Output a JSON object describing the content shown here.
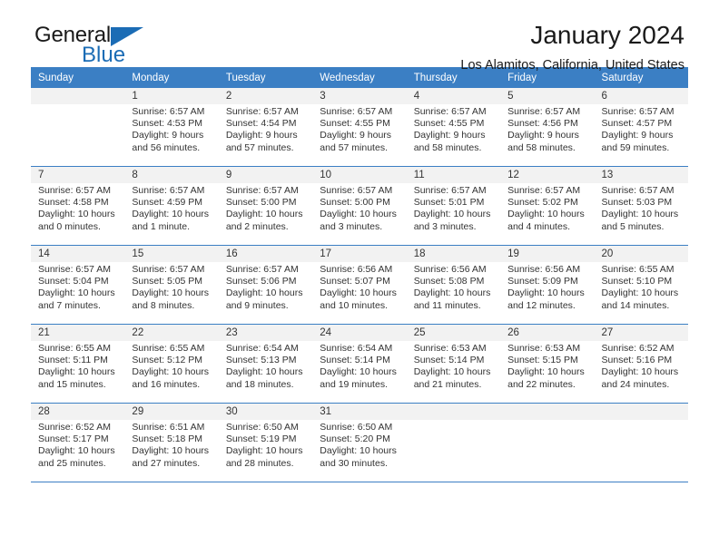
{
  "brand": {
    "name_dark": "General",
    "name_blue": "Blue",
    "triangle_icon": "triangle-icon",
    "accent_color": "#1b6cb5"
  },
  "header": {
    "month_title": "January 2024",
    "location": "Los Alamitos, California, United States"
  },
  "colors": {
    "header_blue": "#3b7fc4",
    "daynum_bg": "#f2f2f2",
    "text": "#333333"
  },
  "calendar": {
    "weekday_headers": [
      "Sunday",
      "Monday",
      "Tuesday",
      "Wednesday",
      "Thursday",
      "Friday",
      "Saturday"
    ],
    "weeks": [
      [
        {
          "day": "",
          "sunrise": "",
          "sunset": "",
          "daylight_l1": "",
          "daylight_l2": "",
          "empty": true
        },
        {
          "day": "1",
          "sunrise": "Sunrise: 6:57 AM",
          "sunset": "Sunset: 4:53 PM",
          "daylight_l1": "Daylight: 9 hours",
          "daylight_l2": "and 56 minutes."
        },
        {
          "day": "2",
          "sunrise": "Sunrise: 6:57 AM",
          "sunset": "Sunset: 4:54 PM",
          "daylight_l1": "Daylight: 9 hours",
          "daylight_l2": "and 57 minutes."
        },
        {
          "day": "3",
          "sunrise": "Sunrise: 6:57 AM",
          "sunset": "Sunset: 4:55 PM",
          "daylight_l1": "Daylight: 9 hours",
          "daylight_l2": "and 57 minutes."
        },
        {
          "day": "4",
          "sunrise": "Sunrise: 6:57 AM",
          "sunset": "Sunset: 4:55 PM",
          "daylight_l1": "Daylight: 9 hours",
          "daylight_l2": "and 58 minutes."
        },
        {
          "day": "5",
          "sunrise": "Sunrise: 6:57 AM",
          "sunset": "Sunset: 4:56 PM",
          "daylight_l1": "Daylight: 9 hours",
          "daylight_l2": "and 58 minutes."
        },
        {
          "day": "6",
          "sunrise": "Sunrise: 6:57 AM",
          "sunset": "Sunset: 4:57 PM",
          "daylight_l1": "Daylight: 9 hours",
          "daylight_l2": "and 59 minutes."
        }
      ],
      [
        {
          "day": "7",
          "sunrise": "Sunrise: 6:57 AM",
          "sunset": "Sunset: 4:58 PM",
          "daylight_l1": "Daylight: 10 hours",
          "daylight_l2": "and 0 minutes."
        },
        {
          "day": "8",
          "sunrise": "Sunrise: 6:57 AM",
          "sunset": "Sunset: 4:59 PM",
          "daylight_l1": "Daylight: 10 hours",
          "daylight_l2": "and 1 minute."
        },
        {
          "day": "9",
          "sunrise": "Sunrise: 6:57 AM",
          "sunset": "Sunset: 5:00 PM",
          "daylight_l1": "Daylight: 10 hours",
          "daylight_l2": "and 2 minutes."
        },
        {
          "day": "10",
          "sunrise": "Sunrise: 6:57 AM",
          "sunset": "Sunset: 5:00 PM",
          "daylight_l1": "Daylight: 10 hours",
          "daylight_l2": "and 3 minutes."
        },
        {
          "day": "11",
          "sunrise": "Sunrise: 6:57 AM",
          "sunset": "Sunset: 5:01 PM",
          "daylight_l1": "Daylight: 10 hours",
          "daylight_l2": "and 3 minutes."
        },
        {
          "day": "12",
          "sunrise": "Sunrise: 6:57 AM",
          "sunset": "Sunset: 5:02 PM",
          "daylight_l1": "Daylight: 10 hours",
          "daylight_l2": "and 4 minutes."
        },
        {
          "day": "13",
          "sunrise": "Sunrise: 6:57 AM",
          "sunset": "Sunset: 5:03 PM",
          "daylight_l1": "Daylight: 10 hours",
          "daylight_l2": "and 5 minutes."
        }
      ],
      [
        {
          "day": "14",
          "sunrise": "Sunrise: 6:57 AM",
          "sunset": "Sunset: 5:04 PM",
          "daylight_l1": "Daylight: 10 hours",
          "daylight_l2": "and 7 minutes."
        },
        {
          "day": "15",
          "sunrise": "Sunrise: 6:57 AM",
          "sunset": "Sunset: 5:05 PM",
          "daylight_l1": "Daylight: 10 hours",
          "daylight_l2": "and 8 minutes."
        },
        {
          "day": "16",
          "sunrise": "Sunrise: 6:57 AM",
          "sunset": "Sunset: 5:06 PM",
          "daylight_l1": "Daylight: 10 hours",
          "daylight_l2": "and 9 minutes."
        },
        {
          "day": "17",
          "sunrise": "Sunrise: 6:56 AM",
          "sunset": "Sunset: 5:07 PM",
          "daylight_l1": "Daylight: 10 hours",
          "daylight_l2": "and 10 minutes."
        },
        {
          "day": "18",
          "sunrise": "Sunrise: 6:56 AM",
          "sunset": "Sunset: 5:08 PM",
          "daylight_l1": "Daylight: 10 hours",
          "daylight_l2": "and 11 minutes."
        },
        {
          "day": "19",
          "sunrise": "Sunrise: 6:56 AM",
          "sunset": "Sunset: 5:09 PM",
          "daylight_l1": "Daylight: 10 hours",
          "daylight_l2": "and 12 minutes."
        },
        {
          "day": "20",
          "sunrise": "Sunrise: 6:55 AM",
          "sunset": "Sunset: 5:10 PM",
          "daylight_l1": "Daylight: 10 hours",
          "daylight_l2": "and 14 minutes."
        }
      ],
      [
        {
          "day": "21",
          "sunrise": "Sunrise: 6:55 AM",
          "sunset": "Sunset: 5:11 PM",
          "daylight_l1": "Daylight: 10 hours",
          "daylight_l2": "and 15 minutes."
        },
        {
          "day": "22",
          "sunrise": "Sunrise: 6:55 AM",
          "sunset": "Sunset: 5:12 PM",
          "daylight_l1": "Daylight: 10 hours",
          "daylight_l2": "and 16 minutes."
        },
        {
          "day": "23",
          "sunrise": "Sunrise: 6:54 AM",
          "sunset": "Sunset: 5:13 PM",
          "daylight_l1": "Daylight: 10 hours",
          "daylight_l2": "and 18 minutes."
        },
        {
          "day": "24",
          "sunrise": "Sunrise: 6:54 AM",
          "sunset": "Sunset: 5:14 PM",
          "daylight_l1": "Daylight: 10 hours",
          "daylight_l2": "and 19 minutes."
        },
        {
          "day": "25",
          "sunrise": "Sunrise: 6:53 AM",
          "sunset": "Sunset: 5:14 PM",
          "daylight_l1": "Daylight: 10 hours",
          "daylight_l2": "and 21 minutes."
        },
        {
          "day": "26",
          "sunrise": "Sunrise: 6:53 AM",
          "sunset": "Sunset: 5:15 PM",
          "daylight_l1": "Daylight: 10 hours",
          "daylight_l2": "and 22 minutes."
        },
        {
          "day": "27",
          "sunrise": "Sunrise: 6:52 AM",
          "sunset": "Sunset: 5:16 PM",
          "daylight_l1": "Daylight: 10 hours",
          "daylight_l2": "and 24 minutes."
        }
      ],
      [
        {
          "day": "28",
          "sunrise": "Sunrise: 6:52 AM",
          "sunset": "Sunset: 5:17 PM",
          "daylight_l1": "Daylight: 10 hours",
          "daylight_l2": "and 25 minutes."
        },
        {
          "day": "29",
          "sunrise": "Sunrise: 6:51 AM",
          "sunset": "Sunset: 5:18 PM",
          "daylight_l1": "Daylight: 10 hours",
          "daylight_l2": "and 27 minutes."
        },
        {
          "day": "30",
          "sunrise": "Sunrise: 6:50 AM",
          "sunset": "Sunset: 5:19 PM",
          "daylight_l1": "Daylight: 10 hours",
          "daylight_l2": "and 28 minutes."
        },
        {
          "day": "31",
          "sunrise": "Sunrise: 6:50 AM",
          "sunset": "Sunset: 5:20 PM",
          "daylight_l1": "Daylight: 10 hours",
          "daylight_l2": "and 30 minutes."
        },
        {
          "day": "",
          "sunrise": "",
          "sunset": "",
          "daylight_l1": "",
          "daylight_l2": "",
          "empty": true
        },
        {
          "day": "",
          "sunrise": "",
          "sunset": "",
          "daylight_l1": "",
          "daylight_l2": "",
          "empty": true
        },
        {
          "day": "",
          "sunrise": "",
          "sunset": "",
          "daylight_l1": "",
          "daylight_l2": "",
          "empty": true
        }
      ]
    ]
  }
}
